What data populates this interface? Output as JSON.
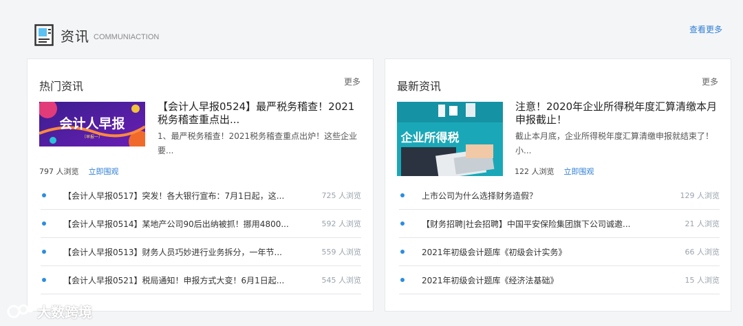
{
  "section": {
    "title": "资讯",
    "subtitle": "COMMUNIACTION",
    "see_more": "查看更多"
  },
  "hot": {
    "title": "热门资讯",
    "more": "更多",
    "featured": {
      "image_text": "会计人早报",
      "image_sub": "〔早报一〕",
      "title": "【会计人早报0524】最严税务稽查！2021税务稽查重点出...",
      "desc": "1、最严税务稽查！2021税务稽查重点出炉！这些企业要...",
      "views": "797 人浏览",
      "link": "立即围观"
    },
    "items": [
      {
        "title": "【会计人早报0517】突发！各大银行宣布：7月1日起，这...",
        "views": "725 人浏览"
      },
      {
        "title": "【会计人早报0514】某地产公司90后出纳被抓！挪用4800...",
        "views": "592 人浏览"
      },
      {
        "title": "【会计人早报0513】财务人员巧妙进行业务拆分，一年节...",
        "views": "559 人浏览"
      },
      {
        "title": "【会计人早报0521】税局通知！申报方式大变！6月1日起...",
        "views": "545 人浏览"
      }
    ]
  },
  "latest": {
    "title": "最新资讯",
    "more": "更多",
    "featured": {
      "image_text": "企业所得税",
      "title": "注意！2020年企业所得税年度汇算清缴本月申报截止！",
      "desc": "截止本月底，企业所得税年度汇算清缴申报就结束了！小...",
      "views": "122 人浏览",
      "link": "立即围观"
    },
    "items": [
      {
        "title": "上市公司为什么选择财务造假？",
        "views": "129 人浏览"
      },
      {
        "title": "【财务招聘|社会招聘】中国平安保险集团旗下公司诚邀...",
        "views": "21 人浏览"
      },
      {
        "title": "2021年初级会计题库《初级会计实务》",
        "views": "66 人浏览"
      },
      {
        "title": "2021年初级会计题库《经济法基础》",
        "views": "15 人浏览"
      }
    ]
  },
  "watermark": "大数跨境",
  "colors": {
    "accent": "#2f7fd6",
    "dot": "#2c8de0",
    "background": "#f4f5f7"
  }
}
